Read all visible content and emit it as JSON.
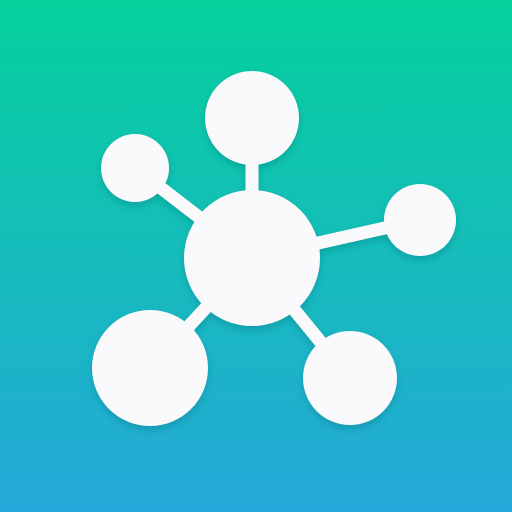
{
  "icon": {
    "name": "network-graph-app-icon",
    "gradient_top": "#05D19C",
    "gradient_bottom": "#25A8DA",
    "glyph_color": "#FAF9FC",
    "shadow_color": "#0B6F78"
  }
}
